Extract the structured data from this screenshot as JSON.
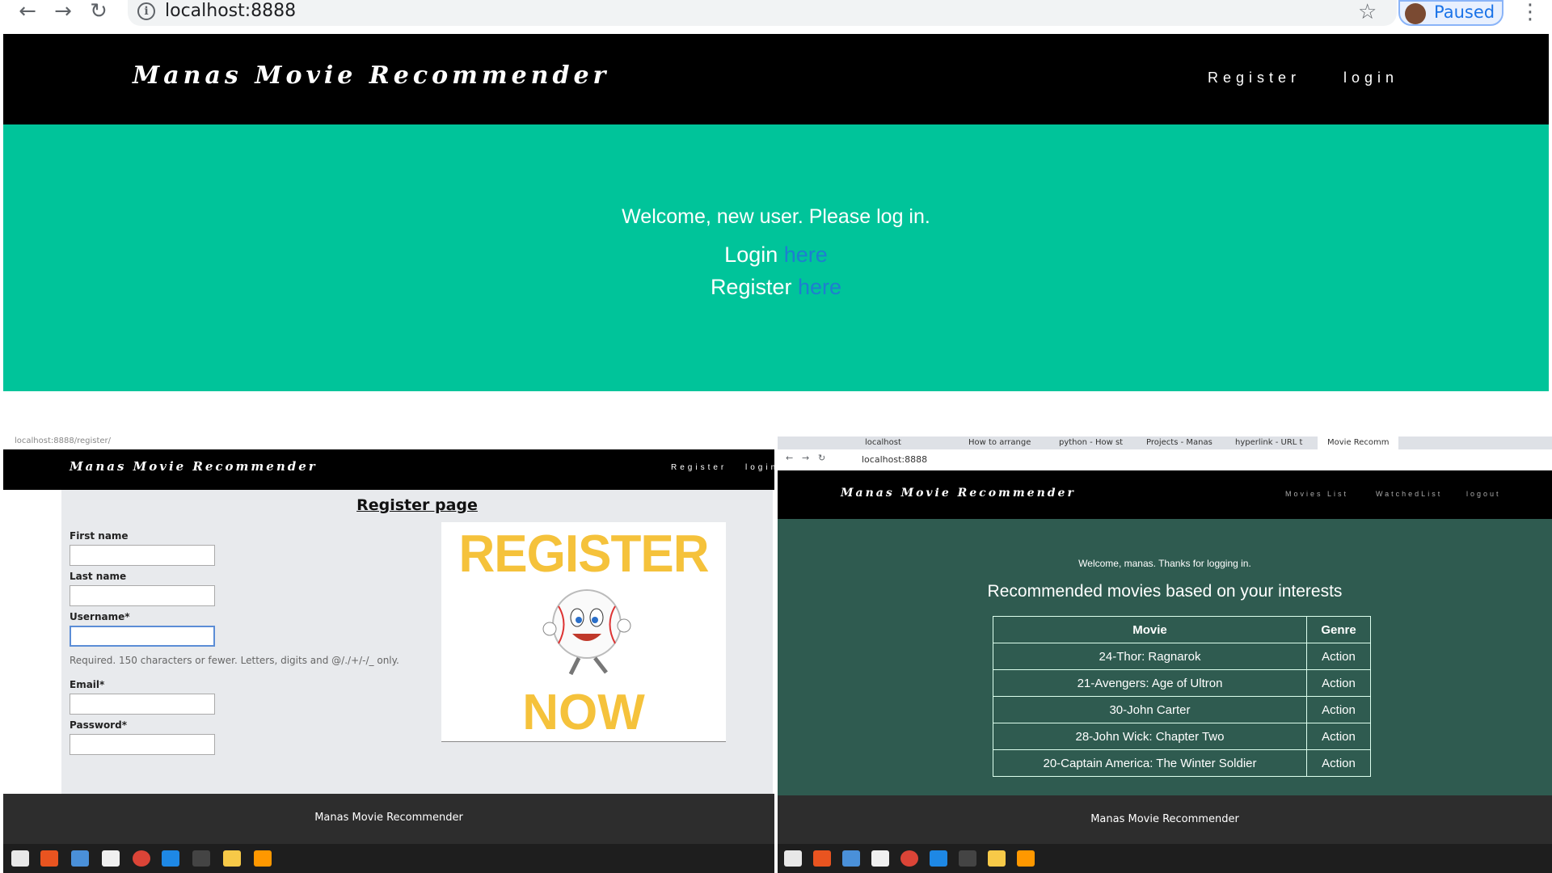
{
  "browser": {
    "url": "localhost:8888",
    "profile_status": "Paused"
  },
  "site": {
    "brand": "Manas Movie Recommender",
    "nav": {
      "register": "Register",
      "login": "login"
    }
  },
  "home": {
    "welcome": "Welcome, new user. Please log in.",
    "login_text": "Login",
    "register_text": "Register",
    "link_text": "here"
  },
  "register_page": {
    "mini_url": "localhost:8888/register/",
    "title": "Register page",
    "fields": {
      "first_name": "First name",
      "last_name": "Last name",
      "username": "Username*",
      "username_help": "Required. 150 characters or fewer. Letters, digits and @/./+/-/_ only.",
      "email": "Email*",
      "password": "Password*"
    },
    "image_text_top": "REGISTER",
    "image_text_bottom": "NOW",
    "footer": "Manas Movie Recommender"
  },
  "logged_in": {
    "tabs": [
      "localhost",
      "How to arrange",
      "python - How st",
      "Projects - Manas",
      "hyperlink - URL t",
      "Movie Recomm"
    ],
    "url": "localhost:8888",
    "nav": {
      "movies_list": "Movies List",
      "watched_list": "WatchedList",
      "logout": "logout"
    },
    "welcome": "Welcome, manas. Thanks for logging in.",
    "heading": "Recommended movies based on your interests",
    "table_headers": {
      "movie": "Movie",
      "genre": "Genre"
    },
    "rows": [
      {
        "movie": "24-Thor: Ragnarok",
        "genre": "Action"
      },
      {
        "movie": "21-Avengers: Age of Ultron",
        "genre": "Action"
      },
      {
        "movie": "30-John Carter",
        "genre": "Action"
      },
      {
        "movie": "28-John Wick: Chapter Two",
        "genre": "Action"
      },
      {
        "movie": "20-Captain America: The Winter Soldier",
        "genre": "Action"
      }
    ],
    "footer": "Manas Movie Recommender"
  },
  "colors": {
    "hero": "#00c49a",
    "dark_teal": "#2f5b50",
    "link": "#1e7ed0"
  },
  "taskbar_icons": [
    "folder-icon",
    "store-icon",
    "document-icon",
    "notes-icon",
    "chrome-icon",
    "vscode-icon",
    "terminal-icon",
    "python-icon",
    "sublime-icon"
  ]
}
